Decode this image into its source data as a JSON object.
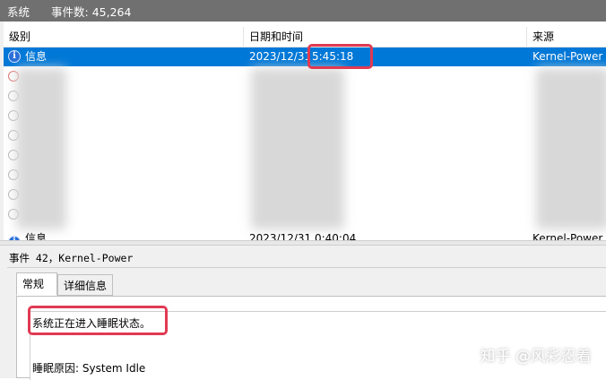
{
  "titlebar": {
    "title": "系统",
    "count_label": "事件数: 45,264"
  },
  "columns": {
    "level": "级别",
    "datetime": "日期和时间",
    "source": "来源"
  },
  "selected_row": {
    "level": "信息",
    "date": "2023/12/31",
    "time": "5:45:18",
    "source": "Kernel-Power"
  },
  "partial_row": {
    "level": "信息",
    "date": "2023/12/31 0:40:04",
    "source": "Kernel-Power"
  },
  "detail": {
    "event_header": "事件 42，Kernel-Power",
    "tabs": [
      "常规",
      "详细信息"
    ],
    "message": "系统正在进入睡眠状态。",
    "reason": "睡眠原因: System Idle"
  },
  "watermark": "知乎 @风彩忍着",
  "colors": {
    "selection": "#0078d7",
    "annotation": "#e03a52",
    "titlebar": "#707070"
  }
}
